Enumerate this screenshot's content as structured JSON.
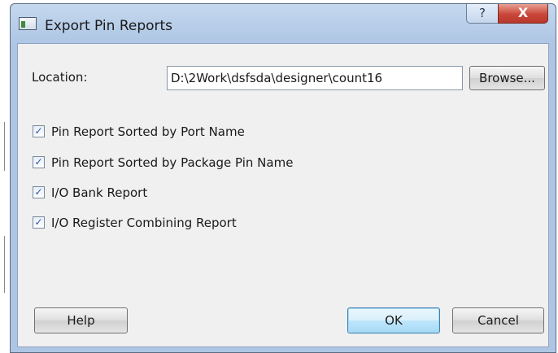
{
  "window": {
    "title": "Export Pin Reports",
    "help_glyph": "?",
    "close_glyph": "X"
  },
  "location": {
    "label": "Location:",
    "value": "D:\\2Work\\dsfsda\\designer\\count16",
    "browse_label": "Browse..."
  },
  "options": [
    {
      "label": "Pin Report Sorted by Port Name",
      "checked": true
    },
    {
      "label": "Pin Report Sorted by Package Pin Name",
      "checked": true
    },
    {
      "label": "I/O Bank Report",
      "checked": true
    },
    {
      "label": "I/O Register Combining Report",
      "checked": true
    }
  ],
  "buttons": {
    "help": "Help",
    "ok": "OK",
    "cancel": "Cancel"
  },
  "icons": {
    "app": "window-app-icon",
    "check": "checkmark-icon"
  },
  "colors": {
    "titlebar": "#b7cde8",
    "close": "#c9473a",
    "default_button": "#bee6fd",
    "checkmark": "#2a56a8"
  }
}
